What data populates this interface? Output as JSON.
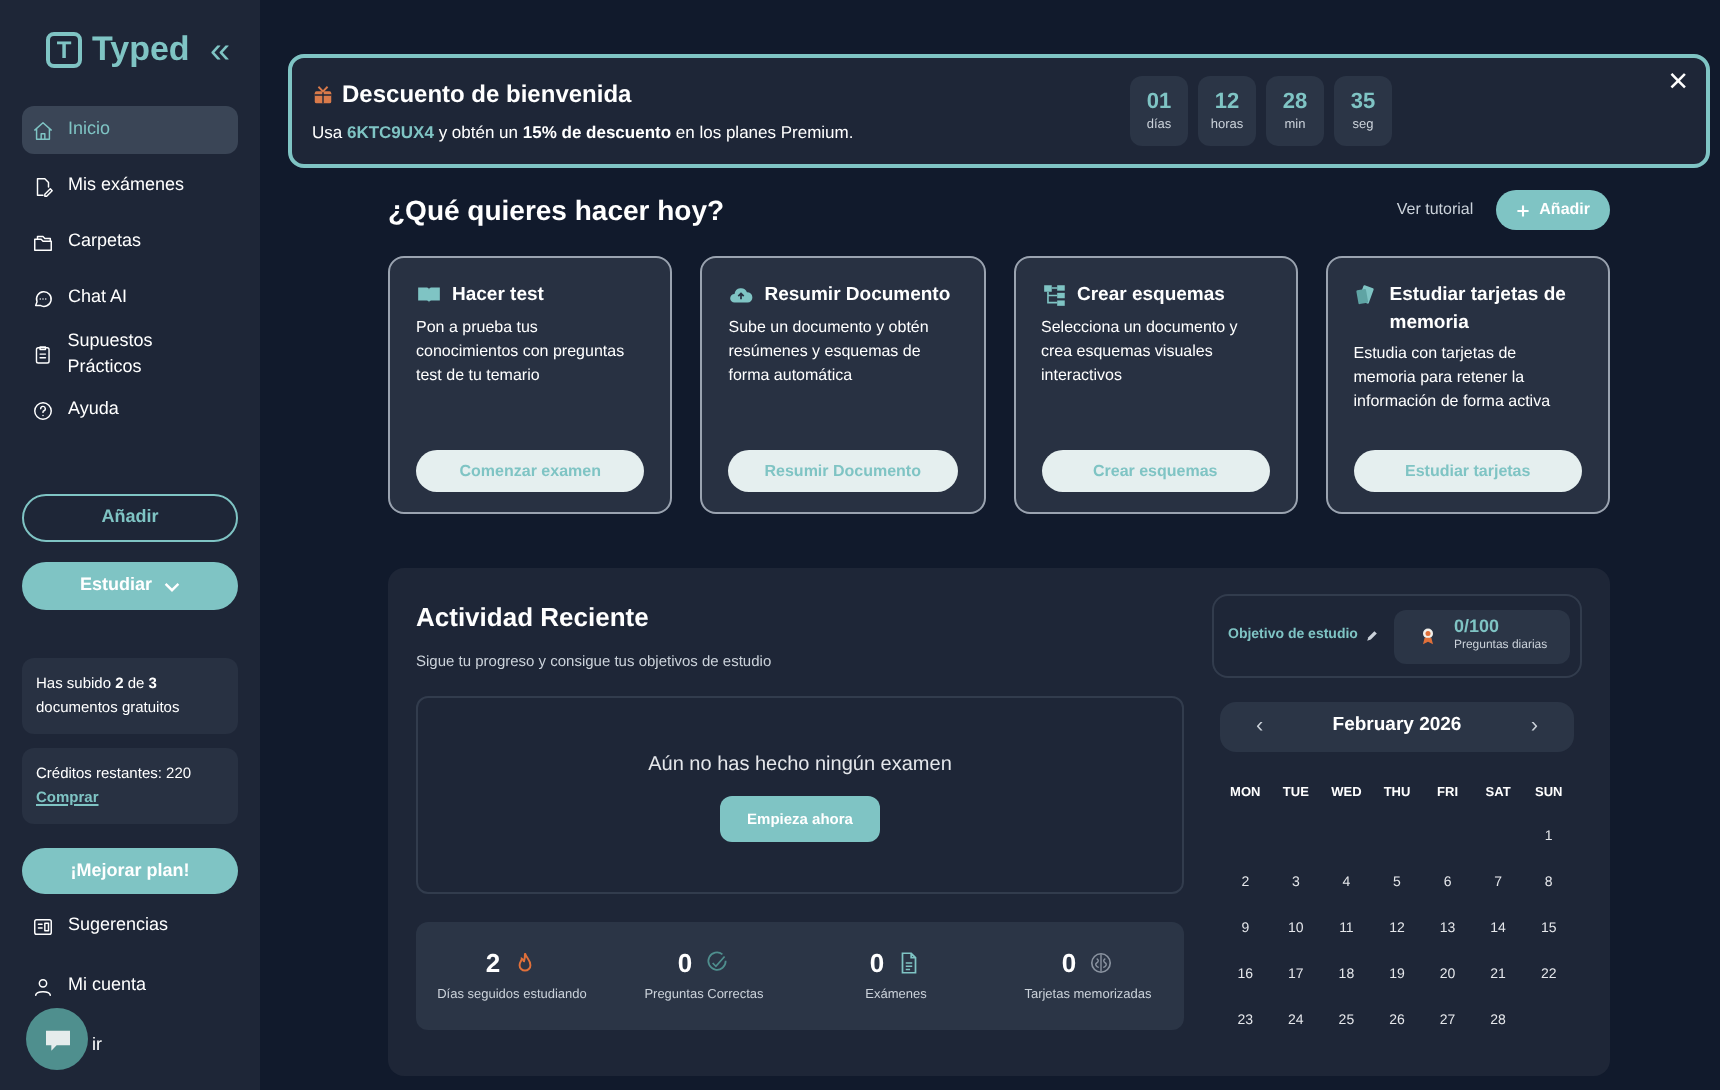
{
  "sidebar": {
    "logo_letter": "T",
    "logo_text": "Typed",
    "collapse": "«",
    "items": [
      {
        "label": "Inicio",
        "selected": true
      },
      {
        "label": "Mis exámenes",
        "selected": false
      },
      {
        "label": "Carpetas",
        "selected": false
      },
      {
        "label": "Chat AI",
        "selected": false
      },
      {
        "label": "Supuestos Prácticos",
        "selected": false
      },
      {
        "label": "Ayuda",
        "selected": false
      }
    ],
    "add_button": "Añadir",
    "study_button": "Estudiar",
    "uploads_note": "Has subido **2** de **3** documentos gratuitos",
    "credits": "Créditos restantes: 220",
    "buy_link": "Comprar",
    "upgrade_button": "¡Mejorar plan!",
    "bottom_items": [
      {
        "label": "Sugerencias"
      },
      {
        "label": "Mi cuenta"
      },
      {
        "label": "ir"
      }
    ]
  },
  "banner": {
    "title": "Descuento de bienvenida",
    "text": "Usa **6KTC9UX4** y obtén un **15% de descuento** en los planes Premium.",
    "countdown": [
      {
        "value": "01",
        "unit": "días"
      },
      {
        "value": "12",
        "unit": "horas"
      },
      {
        "value": "28",
        "unit": "min"
      },
      {
        "value": "35",
        "unit": "seg"
      }
    ],
    "close": "×"
  },
  "heading": "¿Qué quieres hacer hoy?",
  "tutorial_link": "Ver tutorial",
  "add_button": "Añadir",
  "actions": [
    {
      "title": "Hacer test",
      "text": "Pon a prueba tus conocimientos con preguntas test de tu temario",
      "button": "Comenzar examen"
    },
    {
      "title": "Resumir Documento",
      "text": "Sube un documento y obtén resúmenes y esquemas de forma automática",
      "button": "Resumir Documento"
    },
    {
      "title": "Crear esquemas",
      "text": "Selecciona un documento y crea esquemas visuales interactivos",
      "button": "Crear esquemas"
    },
    {
      "title": "Estudiar tarjetas de memoria",
      "text": "Estudia con tarjetas de memoria para retener la información de forma activa",
      "button": "Estudiar tarjetas"
    }
  ],
  "activity": {
    "title": "Actividad Reciente",
    "subtitle": "Sigue tu progreso y consigue tus objetivos de estudio",
    "goal_label": "Objetivo de estudio",
    "goal_value": "0/100",
    "goal_caption": "Preguntas diarias",
    "empty_text": "Aún no has hecho ningún examen",
    "start_button": "Empieza ahora",
    "stats": [
      {
        "value": "2",
        "label": "Días seguidos estudiando"
      },
      {
        "value": "0",
        "label": "Preguntas Correctas"
      },
      {
        "value": "0",
        "label": "Exámenes"
      },
      {
        "value": "0",
        "label": "Tarjetas memorizadas"
      }
    ],
    "calendar": {
      "prev": "‹",
      "month": "February 2026",
      "next": "›",
      "weekdays": [
        "MON",
        "TUE",
        "WED",
        "THU",
        "FRI",
        "SAT",
        "SUN"
      ],
      "weeks": [
        [
          "1"
        ],
        [
          "2",
          "3",
          "4",
          "5",
          "6",
          "7",
          "8"
        ],
        [
          "9",
          "10",
          "11",
          "12",
          "13",
          "14",
          "15"
        ],
        [
          "16",
          "17",
          "18",
          "19",
          "20",
          "21",
          "22"
        ],
        [
          "23",
          "24",
          "25",
          "26",
          "27",
          "28"
        ]
      ]
    }
  }
}
